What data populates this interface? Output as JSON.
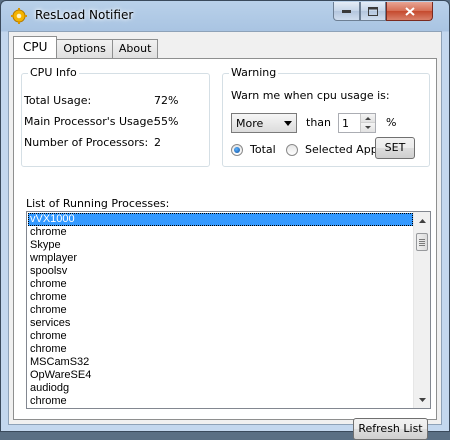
{
  "window": {
    "title": "ResLoad Notifier"
  },
  "tabs": [
    {
      "label": "CPU",
      "active": true
    },
    {
      "label": "Options",
      "active": false
    },
    {
      "label": "About",
      "active": false
    }
  ],
  "cpu_info": {
    "title": "CPU Info",
    "rows": [
      {
        "label": "Total Usage:",
        "value": "72%"
      },
      {
        "label": "Main Processor's Usage:",
        "value": "55%"
      },
      {
        "label": "Number of Processors:",
        "value": "2"
      }
    ]
  },
  "warning": {
    "title": "Warning",
    "prompt": "Warn me when cpu usage is:",
    "comparison": "More",
    "than_label": "than",
    "threshold": "1",
    "percent_label": "%",
    "radio_total": "Total",
    "radio_selected": "Selected App",
    "selected_option": "Total",
    "set_button": "SET"
  },
  "processes": {
    "label": "List of Running Processes:",
    "selected": "vVX1000",
    "items": [
      "vVX1000",
      "chrome",
      "Skype",
      "wmplayer",
      "spoolsv",
      "chrome",
      "chrome",
      "chrome",
      "services",
      "chrome",
      "chrome",
      "MSCamS32",
      "OpWareSE4",
      "audiodg",
      "chrome"
    ]
  },
  "refresh_button": "Refresh List",
  "colors": {
    "selection": "#3399ff",
    "close_button": "#c54a2e",
    "title_bar": "#b9d1ea"
  }
}
